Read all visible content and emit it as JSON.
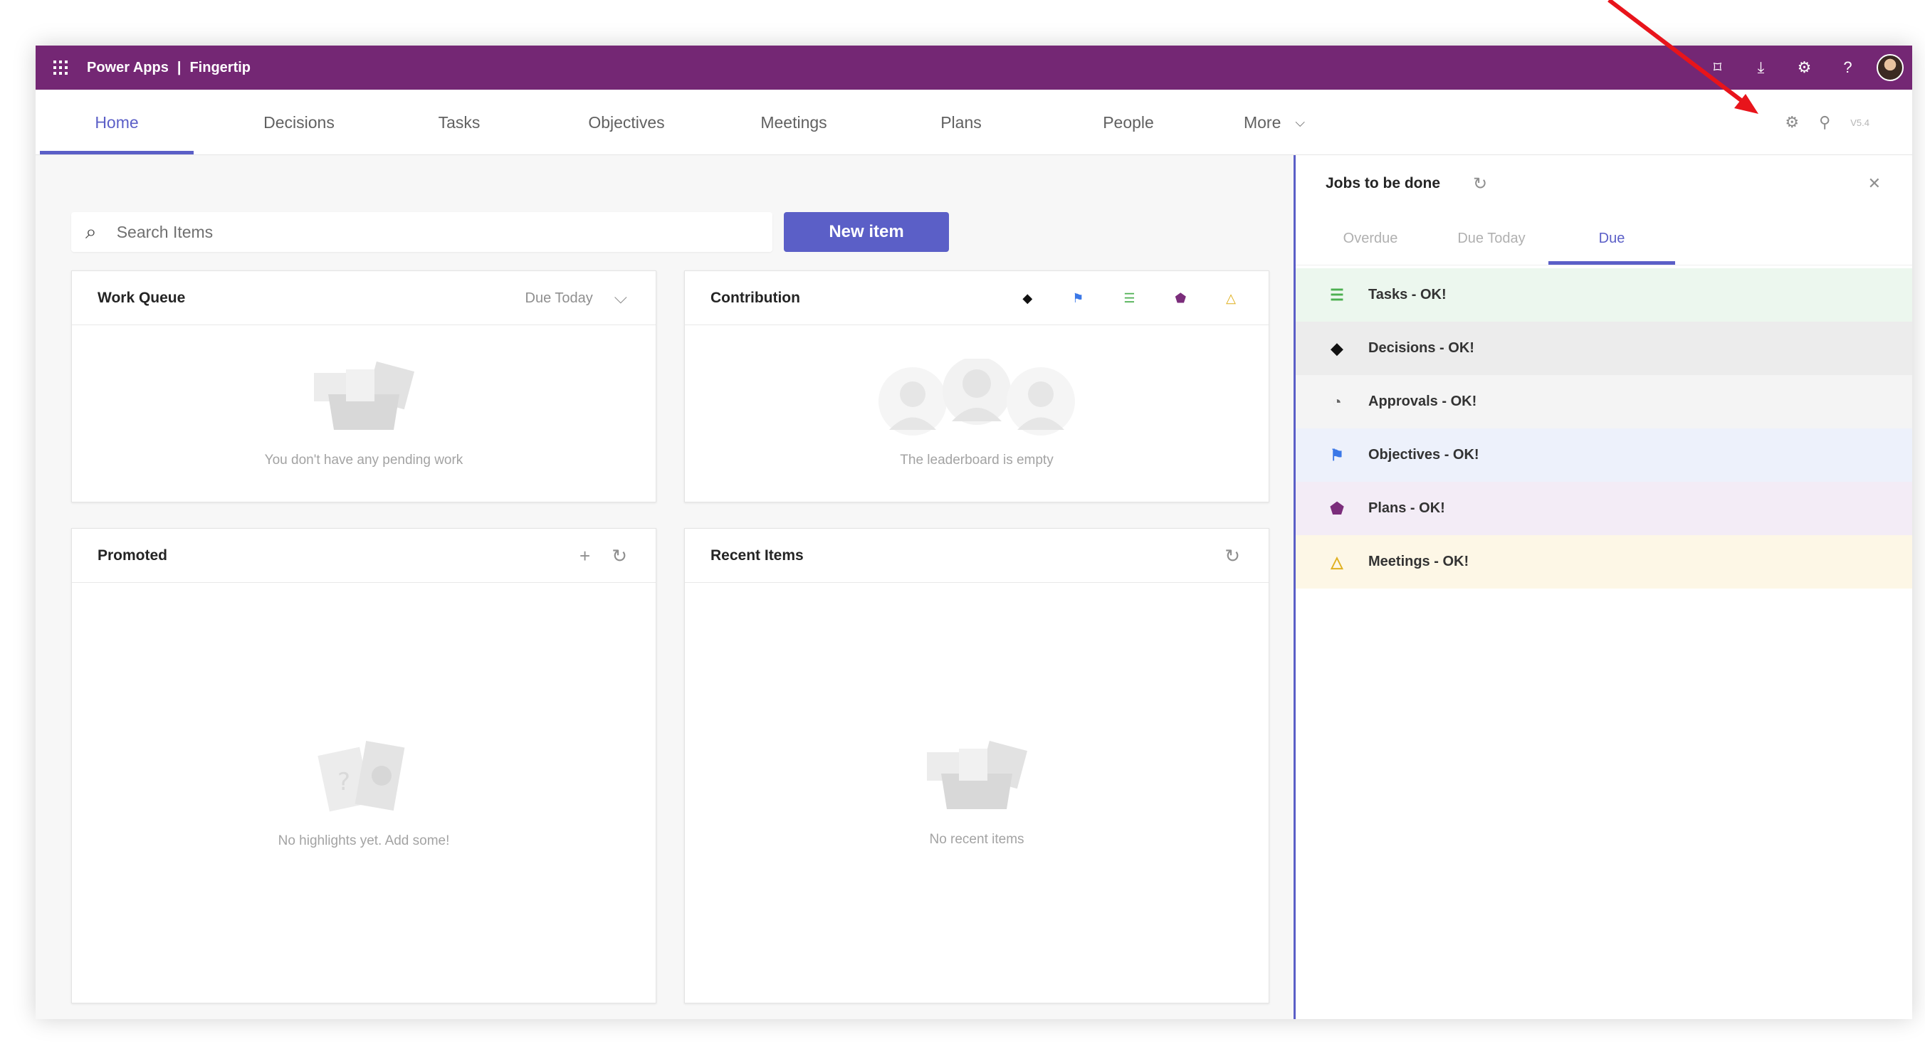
{
  "app": {
    "name": "Power Apps",
    "separator": "|",
    "title": "Fingertip"
  },
  "topbar_icons": [
    "present-icon",
    "download-icon",
    "settings-icon",
    "help-icon",
    "avatar"
  ],
  "topbar_glyphs": {
    "present": "⌑",
    "download": "⤓",
    "settings": "⚙",
    "help": "?"
  },
  "nav": {
    "tabs": [
      "Home",
      "Decisions",
      "Tasks",
      "Objectives",
      "Meetings",
      "Plans",
      "People",
      "More"
    ],
    "active_tab": "Home",
    "right_icons": {
      "settings": "⚙",
      "tags": "⚲",
      "version": "V5.4"
    }
  },
  "search": {
    "placeholder": "Search Items",
    "icon": "⌕"
  },
  "new_item_label": "New item",
  "cards": {
    "work_queue": {
      "title": "Work Queue",
      "filter": "Due Today",
      "chevron": "⌵",
      "empty": "You don't have any pending work"
    },
    "contribution": {
      "title": "Contribution",
      "empty": "The leaderboard is empty",
      "icons": [
        "◆",
        "⚑",
        "☰",
        "⬟",
        "△"
      ]
    },
    "promoted": {
      "title": "Promoted",
      "add": "+",
      "refresh": "↻",
      "empty": "No highlights yet. Add some!"
    },
    "recent": {
      "title": "Recent Items",
      "refresh": "↻",
      "empty": "No recent items"
    }
  },
  "side_panel": {
    "title": "Jobs to be done",
    "refresh": "↻",
    "close": "✕",
    "tabs": [
      "Overdue",
      "Due Today",
      "Due"
    ],
    "active_tab": "Due",
    "jobs": [
      {
        "label": "Tasks - OK!",
        "icon": "☰",
        "icon_name": "tasks-icon",
        "color": "#4caf50",
        "bg": "#ecf7ee"
      },
      {
        "label": "Decisions - OK!",
        "icon": "◆",
        "icon_name": "decisions-icon",
        "color": "#111111",
        "bg": "#ececec"
      },
      {
        "label": "Approvals - OK!",
        "icon": "◔",
        "icon_name": "approvals-icon",
        "color": "#666666",
        "bg": "#f4f4f4"
      },
      {
        "label": "Objectives - OK!",
        "icon": "⚑",
        "icon_name": "objectives-icon",
        "color": "#3b78e7",
        "bg": "#edf1fb"
      },
      {
        "label": "Plans - OK!",
        "icon": "⬟",
        "icon_name": "plans-icon",
        "color": "#7b2d7b",
        "bg": "#f3ecf6"
      },
      {
        "label": "Meetings - OK!",
        "icon": "△",
        "icon_name": "meetings-icon",
        "color": "#e0b020",
        "bg": "#fdf7e6"
      }
    ]
  },
  "colors": {
    "brand": "#742774",
    "accent": "#5b5fc7",
    "arrow": "#e8141b"
  }
}
